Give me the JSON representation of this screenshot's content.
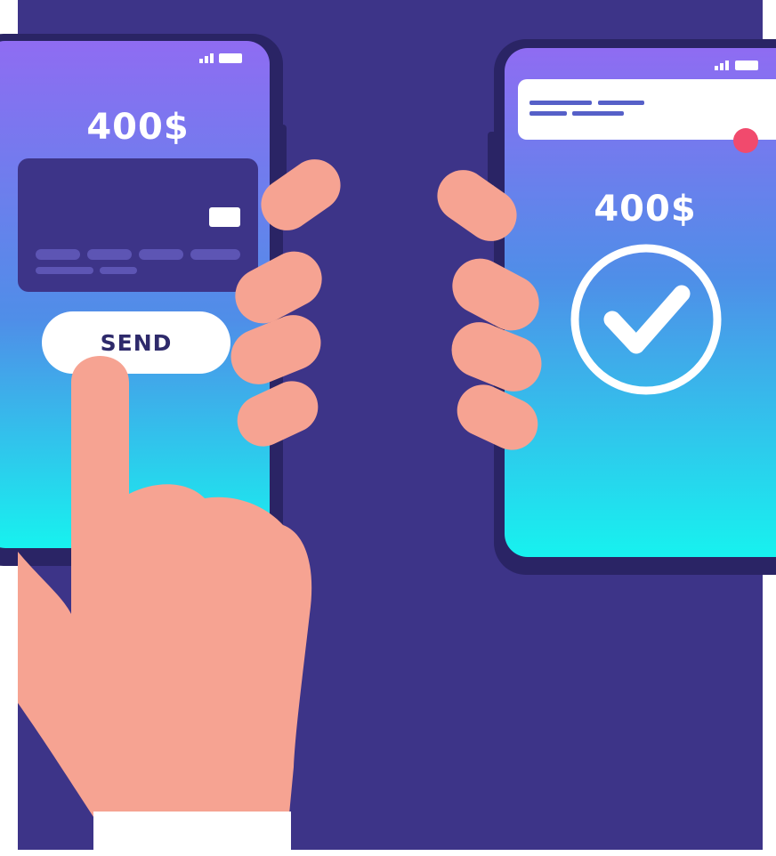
{
  "colors": {
    "background": "#3d3488",
    "phone_body": "#2a2465",
    "screen_top": "#8f6cf2",
    "screen_bottom": "#17f2ef",
    "card": "#3d3488",
    "skin": "#f6a392",
    "cuff": "#ffffff",
    "notification_dot": "#f14a6d",
    "notification_lines": "#5660c8"
  },
  "sender_phone": {
    "amount": "400$",
    "send_button_label": "SEND",
    "status_icons": [
      "signal-icon",
      "battery-icon"
    ],
    "card_icons": [
      "card-chip-icon"
    ]
  },
  "receiver_phone": {
    "amount": "400$",
    "status_icons": [
      "signal-icon",
      "battery-icon"
    ],
    "success_icon": "check-circle-icon"
  }
}
